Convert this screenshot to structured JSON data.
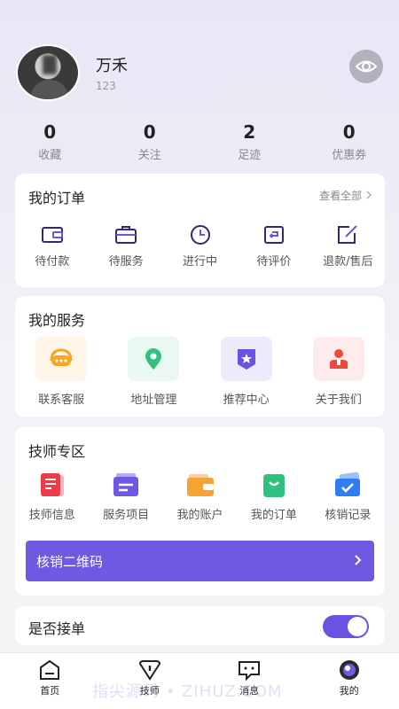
{
  "profile": {
    "name": "万禾",
    "uid": "123"
  },
  "stats": [
    {
      "num": "0",
      "label": "收藏"
    },
    {
      "num": "0",
      "label": "关注"
    },
    {
      "num": "2",
      "label": "足迹"
    },
    {
      "num": "0",
      "label": "优惠券"
    }
  ],
  "orders": {
    "title": "我的订单",
    "view_all": "查看全部",
    "items": [
      {
        "label": "待付款",
        "icon": "wallet-icon"
      },
      {
        "label": "待服务",
        "icon": "briefcase-icon"
      },
      {
        "label": "进行中",
        "icon": "clock-icon"
      },
      {
        "label": "待评价",
        "icon": "undo-icon"
      },
      {
        "label": "退款/售后",
        "icon": "edit-icon"
      }
    ]
  },
  "services": {
    "title": "我的服务",
    "items": [
      {
        "label": "联系客服",
        "icon": "headset-icon"
      },
      {
        "label": "地址管理",
        "icon": "location-pin-icon"
      },
      {
        "label": "推荐中心",
        "icon": "star-badge-icon"
      },
      {
        "label": "关于我们",
        "icon": "person-icon"
      }
    ]
  },
  "tech": {
    "title": "技师专区",
    "items": [
      {
        "label": "技师信息",
        "icon": "document-icon"
      },
      {
        "label": "服务项目",
        "icon": "list-icon"
      },
      {
        "label": "我的账户",
        "icon": "wallet-icon"
      },
      {
        "label": "我的订单",
        "icon": "shopping-bag-icon"
      },
      {
        "label": "核销记录",
        "icon": "ticket-check-icon"
      }
    ],
    "qr_label": "核销二维码"
  },
  "accept": {
    "label": "是否接单",
    "enabled": true
  },
  "tabbar": [
    {
      "label": "首页",
      "icon": "home-icon"
    },
    {
      "label": "技师",
      "icon": "technician-icon"
    },
    {
      "label": "消息",
      "icon": "message-icon"
    },
    {
      "label": "我的",
      "icon": "profile-icon"
    }
  ],
  "watermark": "指尖源码 • ZIHUZ.COM",
  "colors": {
    "accent": "#7158e2",
    "toggle": "#6a53e0"
  }
}
